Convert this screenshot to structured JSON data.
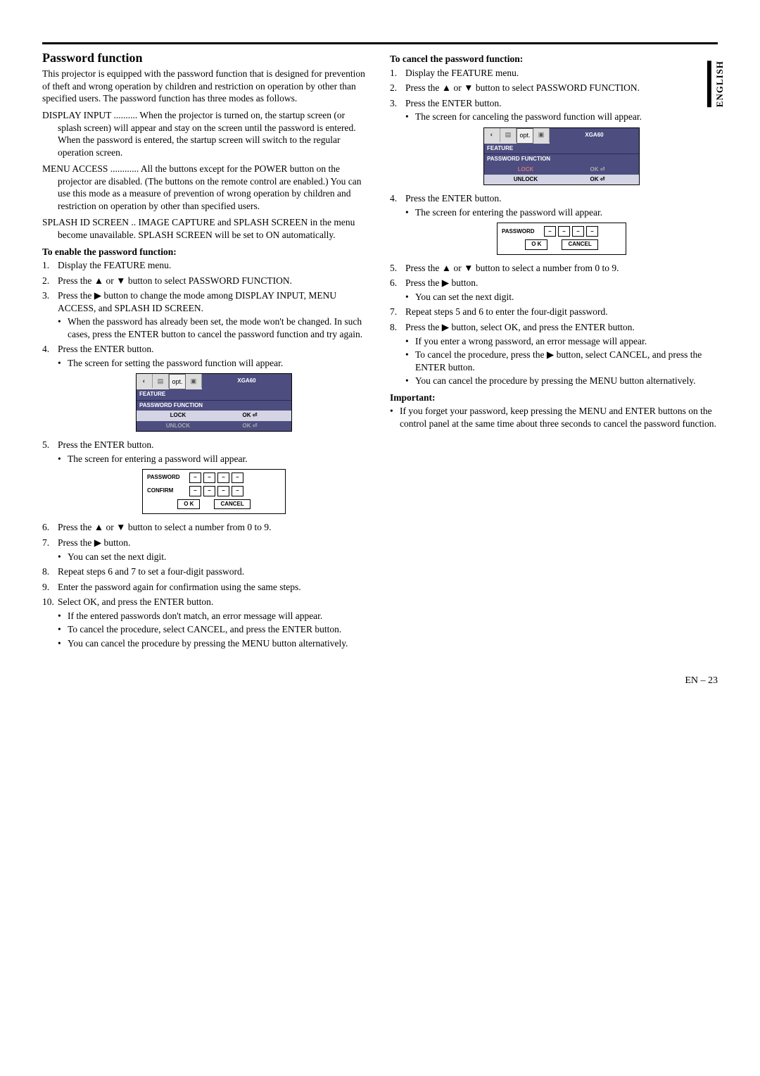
{
  "sideTab": "ENGLISH",
  "pageNumber": "EN – 23",
  "left": {
    "heading": "Password function",
    "intro": "This projector is equipped with the password function that is designed for prevention of theft and wrong operation by children and restriction on operation by other than specified users. The password function has three modes as follows.",
    "modes": [
      {
        "label": "DISPLAY INPUT ..........",
        "text": "When the projector is turned on, the startup screen (or splash screen) will appear and stay on the screen until the password is entered. When the password is entered, the startup screen will switch to the regular operation screen."
      },
      {
        "label": "MENU ACCESS ............",
        "text": "All the buttons except for the POWER button on the projector are disabled. (The buttons on the remote control are enabled.) You can use this mode as a measure of prevention of wrong operation by children and restriction on operation by other than specified users."
      },
      {
        "label": "SPLASH ID SCREEN ..",
        "text": "IMAGE CAPTURE and SPLASH SCREEN in the menu become unavailable. SPLASH SCREEN will be set to ON automatically."
      }
    ],
    "enableHeading": "To enable the password function:",
    "enableSteps": {
      "s1": "Display the FEATURE menu.",
      "s2a": "Press the ",
      "s2b": " or ",
      "s2c": " button to select PASSWORD FUNCTION.",
      "s3a": "Press the ",
      "s3b": " button to change the mode among DISPLAY INPUT, MENU ACCESS, and SPLASH ID SCREEN.",
      "s3bul": "When the password has already been set, the mode won't be changed. In such cases, press the ENTER button to cancel the password function and try again.",
      "s4": "Press the ENTER button.",
      "s4bul": "The screen for setting the password function will appear.",
      "s5": "Press the ENTER button.",
      "s5bul": "The screen for entering a password will appear.",
      "s6a": "Press the ",
      "s6b": " or ",
      "s6c": " button to select a number from 0 to 9.",
      "s7a": "Press the ",
      "s7b": " button.",
      "s7bul": "You can set the next digit.",
      "s8": "Repeat steps 6 and 7 to set a four-digit password.",
      "s9": "Enter the password again for confirmation using the same steps.",
      "s10": "Select OK, and press the ENTER button.",
      "s10b1": "If the entered passwords don't match, an error message will appear.",
      "s10b2": "To cancel the procedure, select CANCEL, and press the ENTER button.",
      "s10b3": "You can cancel the procedure by pressing the MENU button alternatively."
    }
  },
  "right": {
    "cancelHeading": "To cancel the password function:",
    "s1": "Display the FEATURE menu.",
    "s2a": "Press the ",
    "s2b": " or ",
    "s2c": " button to select PASSWORD FUNCTION.",
    "s3": "Press the ENTER button.",
    "s3bul": "The screen for canceling the password function will appear.",
    "s4": "Press the ENTER button.",
    "s4bul": "The screen for entering the password will appear.",
    "s5a": "Press the ",
    "s5b": " or ",
    "s5c": " button to select a number from 0 to 9.",
    "s6a": "Press the ",
    "s6b": " button.",
    "s6bul": "You can set the next digit.",
    "s7": "Repeat steps 5 and 6 to enter the four-digit password.",
    "s8a": "Press the ",
    "s8b": " button, select OK, and press the ENTER button.",
    "s8b1": "If you enter a wrong password, an error message will appear.",
    "s8b2a": "To cancel the procedure, press the ",
    "s8b2b": " button, select CANCEL, and press the ENTER button.",
    "s8b3": "You can cancel the procedure by pressing the MENU button alternatively.",
    "importantHeading": "Important:",
    "importantBullet": "If you forget your password, keep pressing the MENU and ENTER buttons on the control panel at the same time about three seconds to cancel the password function."
  },
  "osd": {
    "resolution": "XGA60",
    "feature": "FEATURE",
    "pwfunc": "PASSWORD FUNCTION",
    "lock": "LOCK",
    "unlock": "UNLOCK",
    "ok": "OK",
    "iconOpt": "opt."
  },
  "pwBox": {
    "password": "PASSWORD",
    "confirm": "CONFIRM",
    "digit": "–",
    "ok": "O K",
    "cancel": "CANCEL"
  },
  "glyphs": {
    "up": "▲",
    "down": "▼",
    "right": "▶"
  }
}
